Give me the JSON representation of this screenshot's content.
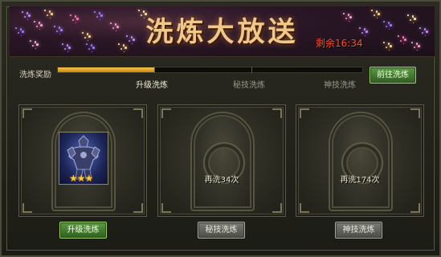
{
  "banner": {
    "title": "洗炼大放送",
    "timer": "剩余16:34"
  },
  "progress": {
    "label": "洗炼奖励",
    "fraction": 0.32,
    "milestones": [
      {
        "label": "升级洗炼",
        "active": true
      },
      {
        "label": "秘技洗炼",
        "active": false
      },
      {
        "label": "神技洗炼",
        "active": false
      }
    ],
    "goto_button": "前往洗炼"
  },
  "panels": [
    {
      "item_icon": "armored-warrior-icon",
      "stars": "★★★",
      "retries": "",
      "button": "升级洗炼",
      "button_style": "green"
    },
    {
      "item_icon": "",
      "stars": "",
      "retries": "再洗34次",
      "button": "秘技洗炼",
      "button_style": "gray"
    },
    {
      "item_icon": "",
      "stars": "",
      "retries": "再洗174次",
      "button": "神技洗炼",
      "button_style": "gray"
    }
  ],
  "colors": {
    "title": "#f0c88a",
    "timer": "#ff4a2a",
    "progress_fill": "#e8a82c",
    "green_button": "#4a8336",
    "gray_button": "#66665f"
  }
}
